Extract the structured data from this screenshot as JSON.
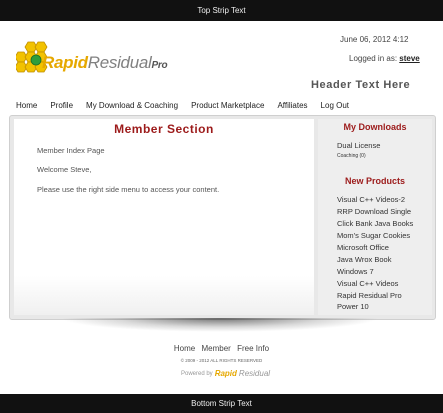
{
  "top_strip": "Top Strip Text",
  "bottom_strip": "Bottom Strip Text",
  "logo": {
    "word1": "Rapid",
    "word2": "Residual",
    "word3": "Pro"
  },
  "date": "June 06, 2012 4:12",
  "login": {
    "prefix": "Logged in as:",
    "username": "steve"
  },
  "header_text": "Header Text Here",
  "nav": [
    "Home",
    "Profile",
    "My Download & Coaching",
    "Product Marketplace",
    "Affiliates",
    "Log Out"
  ],
  "main": {
    "title": "Member Section",
    "page_label": "Member Index Page",
    "welcome": "Welcome Steve,",
    "instruction": "Please use the right side menu to access your content."
  },
  "sidebar": {
    "downloads_heading": "My Downloads",
    "downloads": [
      {
        "label": "Dual License",
        "sub": "Coaching (0)"
      }
    ],
    "products_heading": "New Products",
    "products": [
      "Visual C++ Videos-2",
      "RRP Download Single",
      "Click Bank Java Books",
      "Mom's Sugar Cookies",
      "Microsoft Office",
      "Java Wrox Book",
      "Windows 7",
      "Visual C++ Videos",
      "Rapid Residual Pro",
      "Power 10"
    ]
  },
  "footer": {
    "links": [
      "Home",
      "Member",
      "Free Info"
    ],
    "copyright": "© 2009 - 2012 ALL RIGHTS RESERVED",
    "powered_by": "Powered by",
    "powered_logo1": "Rapid",
    "powered_logo2": "Residual"
  },
  "colors": {
    "strip": "#111111",
    "accent_red": "#9c1a1a",
    "logo_gold": "#e6a800"
  }
}
